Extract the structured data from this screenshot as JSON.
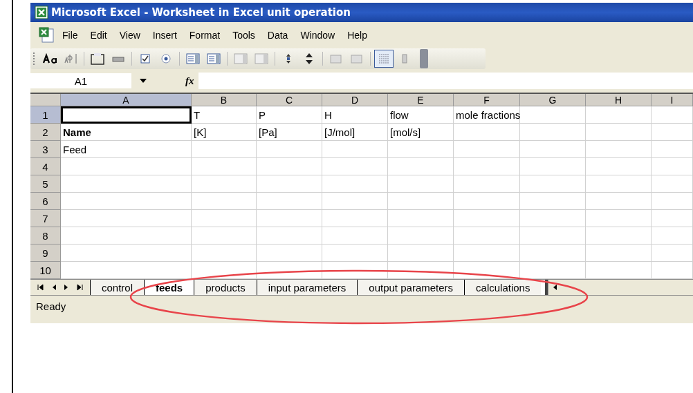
{
  "window": {
    "title": "Microsoft Excel - Worksheet in Excel unit operation"
  },
  "menu": [
    "File",
    "Edit",
    "View",
    "Insert",
    "Format",
    "Tools",
    "Data",
    "Window",
    "Help"
  ],
  "name_box": "A1",
  "fx": "fx",
  "columns": [
    {
      "label": "A",
      "selected": true
    },
    {
      "label": "B",
      "selected": false
    },
    {
      "label": "C",
      "selected": false
    },
    {
      "label": "D",
      "selected": false
    },
    {
      "label": "E",
      "selected": false
    },
    {
      "label": "F",
      "selected": false
    },
    {
      "label": "G",
      "selected": false
    },
    {
      "label": "H",
      "selected": false
    },
    {
      "label": "I",
      "selected": false
    }
  ],
  "rows": [
    {
      "label": "1",
      "selected": true,
      "cells": [
        {
          "active": true
        },
        {
          "text": "T",
          "active": false
        },
        {
          "text": "P",
          "active": false
        },
        {
          "text": "H",
          "active": false
        },
        {
          "text": "flow",
          "active": false
        },
        {
          "text": "mole fractions",
          "active": false
        },
        {
          "active": false
        },
        {
          "active": false
        },
        {
          "active": false
        }
      ]
    },
    {
      "label": "2",
      "selected": false,
      "cells": [
        {
          "text": "Name",
          "bold": true,
          "active": false
        },
        {
          "text": "[K]",
          "active": false
        },
        {
          "text": "[Pa]",
          "active": false
        },
        {
          "text": "[J/mol]",
          "active": false
        },
        {
          "text": "[mol/s]",
          "active": false
        },
        {
          "active": false
        },
        {
          "active": false
        },
        {
          "active": false
        },
        {
          "active": false
        }
      ]
    },
    {
      "label": "3",
      "selected": false,
      "cells": [
        {
          "text": "Feed",
          "active": false
        },
        {
          "active": false
        },
        {
          "active": false
        },
        {
          "active": false
        },
        {
          "active": false
        },
        {
          "active": false
        },
        {
          "active": false
        },
        {
          "active": false
        },
        {
          "active": false
        }
      ]
    },
    {
      "label": "4",
      "selected": false,
      "cells": []
    },
    {
      "label": "5",
      "selected": false,
      "cells": []
    },
    {
      "label": "6",
      "selected": false,
      "cells": []
    },
    {
      "label": "7",
      "selected": false,
      "cells": []
    },
    {
      "label": "8",
      "selected": false,
      "cells": []
    },
    {
      "label": "9",
      "selected": false,
      "cells": []
    },
    {
      "label": "10",
      "selected": false,
      "cells": []
    }
  ],
  "sheet_tabs": [
    {
      "label": "control",
      "selected": false
    },
    {
      "label": "feeds",
      "selected": true
    },
    {
      "label": "products",
      "selected": false
    },
    {
      "label": "input parameters",
      "selected": false
    },
    {
      "label": "output parameters",
      "selected": false
    },
    {
      "label": "calculations",
      "selected": false
    }
  ],
  "status_bar": {
    "text": "Ready"
  }
}
